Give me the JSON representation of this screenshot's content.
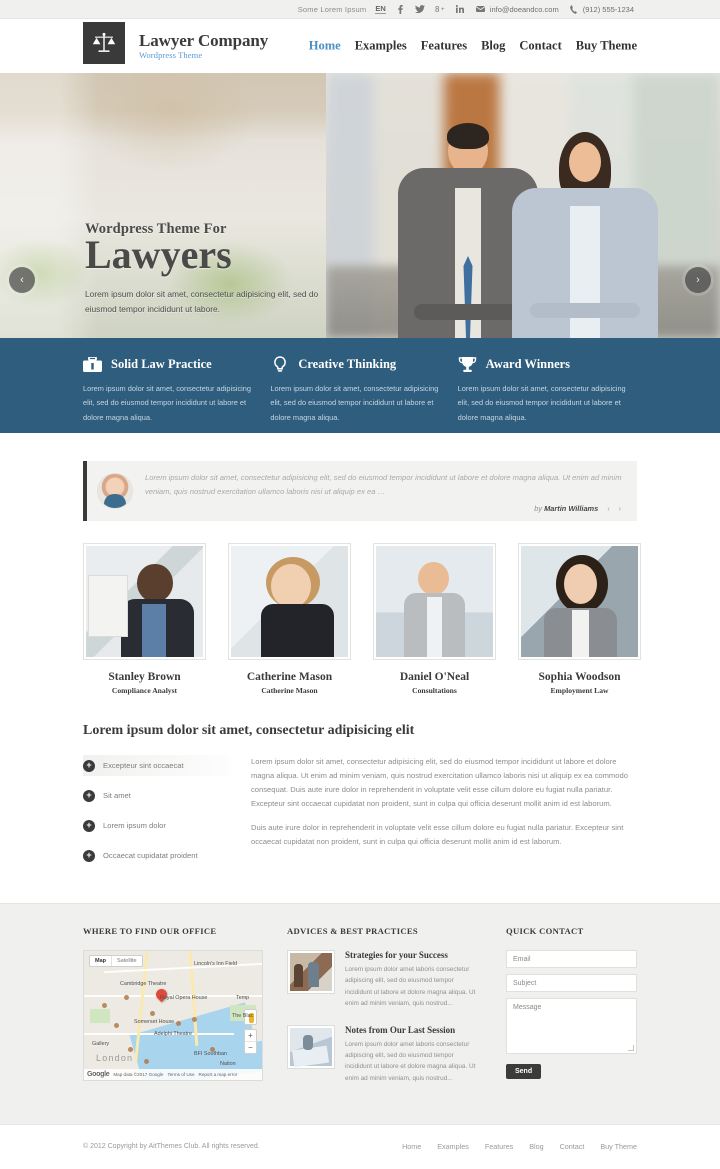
{
  "topbar": {
    "tagline": "Some Lorem Ipsum",
    "lang": "EN",
    "social": [
      "facebook-icon",
      "twitter-icon",
      "google-plus-icon",
      "linkedin-icon"
    ],
    "email": "info@doeandco.com",
    "phone": "(912) 555-1234"
  },
  "header": {
    "logo_icon": "scales-of-justice-icon",
    "title": "Lawyer Company",
    "subtitle": "Wordpress Theme",
    "nav": [
      {
        "label": "Home",
        "active": true
      },
      {
        "label": "Examples",
        "active": false
      },
      {
        "label": "Features",
        "active": false
      },
      {
        "label": "Blog",
        "active": false
      },
      {
        "label": "Contact",
        "active": false
      },
      {
        "label": "Buy Theme",
        "active": false
      }
    ]
  },
  "hero": {
    "kicker": "Wordpress Theme For",
    "title": "Lawyers",
    "description": "Lorem ipsum dolor sit amet, consectetur adipisicing elit, sed do eiusmod tempor incididunt ut labore.",
    "prev_label": "‹",
    "next_label": "›"
  },
  "features": [
    {
      "icon": "briefcase-icon",
      "title": "Solid Law Practice",
      "text": "Lorem ipsum dolor sit amet, consectetur adipisicing elit, sed do eiusmod tempor incididunt ut labore et dolore magna aliqua."
    },
    {
      "icon": "lightbulb-icon",
      "title": "Creative Thinking",
      "text": "Lorem ipsum dolor sit amet, consectetur adipisicing elit, sed do eiusmod tempor incididunt ut labore et dolore magna aliqua."
    },
    {
      "icon": "trophy-icon",
      "title": "Award Winners",
      "text": "Lorem ipsum dolor sit amet, consectetur adipisicing elit, sed do eiusmod tempor incididunt ut labore et dolore magna aliqua."
    }
  ],
  "testimonial": {
    "text": "Lorem ipsum dolor sit amet, consectetur adipisicing elit, sed do eiusmod tempor incididunt ut labore et dolore magna aliqua. Ut enim ad minim veniam, quis nostrud exercitation ullamco laboris nisi ut aliquip ex ea …",
    "by_prefix": "by",
    "author": "Martin Williams",
    "prev": "‹",
    "next": "›"
  },
  "team": [
    {
      "name": "Stanley Brown",
      "role": "Compliance Analyst"
    },
    {
      "name": "Catherine Mason",
      "role": "Catherine Mason"
    },
    {
      "name": "Daniel O'Neal",
      "role": "Consultations"
    },
    {
      "name": "Sophia Woodson",
      "role": "Employment Law"
    }
  ],
  "section2": {
    "title": "Lorem ipsum dolor sit amet, consectetur adipisicing elit",
    "accordion": [
      {
        "label": "Excepteur sint occaecat",
        "active": true
      },
      {
        "label": "Sit amet",
        "active": false
      },
      {
        "label": "Lorem ipsum dolor",
        "active": false
      },
      {
        "label": "Occaecat cupidatat proident",
        "active": false
      }
    ],
    "paragraphs": [
      "Lorem ipsum dolor sit amet, consectetur adipisicing elit, sed do eiusmod tempor incididunt ut labore et dolore magna aliqua. Ut enim ad minim veniam, quis nostrud exercitation ullamco laboris nisi ut aliquip ex ea commodo consequat. Duis aute irure dolor in reprehenderit in voluptate velit esse cillum dolore eu fugiat nulla pariatur. Excepteur sint occaecat cupidatat non proident, sunt in culpa qui officia deserunt mollit anim id est laborum.",
      "Duis aute irure dolor in reprehenderit in voluptate velit esse cillum dolore eu fugiat nulla pariatur. Excepteur sint occaecat cupidatat non proident, sunt in culpa qui officia deserunt mollit anim id est laborum."
    ]
  },
  "footer": {
    "office": {
      "title": "WHERE TO FIND OUR OFFICE",
      "map": {
        "type_label": "Map",
        "satellite_label": "Satellite",
        "zoom_in": "+",
        "zoom_out": "−",
        "labels": [
          "Lincoln's Inn Field",
          "Cambridge Theatre",
          "Royal Opera House",
          "Temp",
          "The Blac",
          "Somerset House",
          "Adelphi Theatre",
          "Gallery",
          "BFI Southban",
          "Nation",
          "London"
        ],
        "attribution": "Map data ©2017 Google",
        "terms": "Terms of Use",
        "report": "Report a map error",
        "logo": "Google"
      }
    },
    "advices": {
      "title": "ADVICES & BEST PRACTICES",
      "posts": [
        {
          "title": "Strategies for your Success",
          "text": "Lorem ipsum dolor amet laboris consectetur adipiscing elit, sed do eiusmod tempor incididunt ut labore et dolore magna aliqua. Ut enim ad minim veniam, quis nostrud..."
        },
        {
          "title": "Notes from Our Last Session",
          "text": "Lorem ipsum dolor amet laboris consectetur adipiscing elit, sed do eiusmod tempor incididunt ut labore et dolore magna aliqua. Ut enim ad minim veniam, quis nostrud..."
        }
      ]
    },
    "contact": {
      "title": "QUICK CONTACT",
      "email_placeholder": "Email",
      "subject_placeholder": "Subject",
      "message_placeholder": "Message",
      "send_label": "Send"
    }
  },
  "bottombar": {
    "copyright": "© 2012 Copyright by AitThemes Club. All rights reserved.",
    "nav": [
      "Home",
      "Examples",
      "Features",
      "Blog",
      "Contact",
      "Buy Theme"
    ]
  },
  "colors": {
    "accent_blue": "#4a90c4",
    "band_blue": "#2e5d7d",
    "dark": "#3b3b3b",
    "light_bg": "#f0f0ee"
  }
}
